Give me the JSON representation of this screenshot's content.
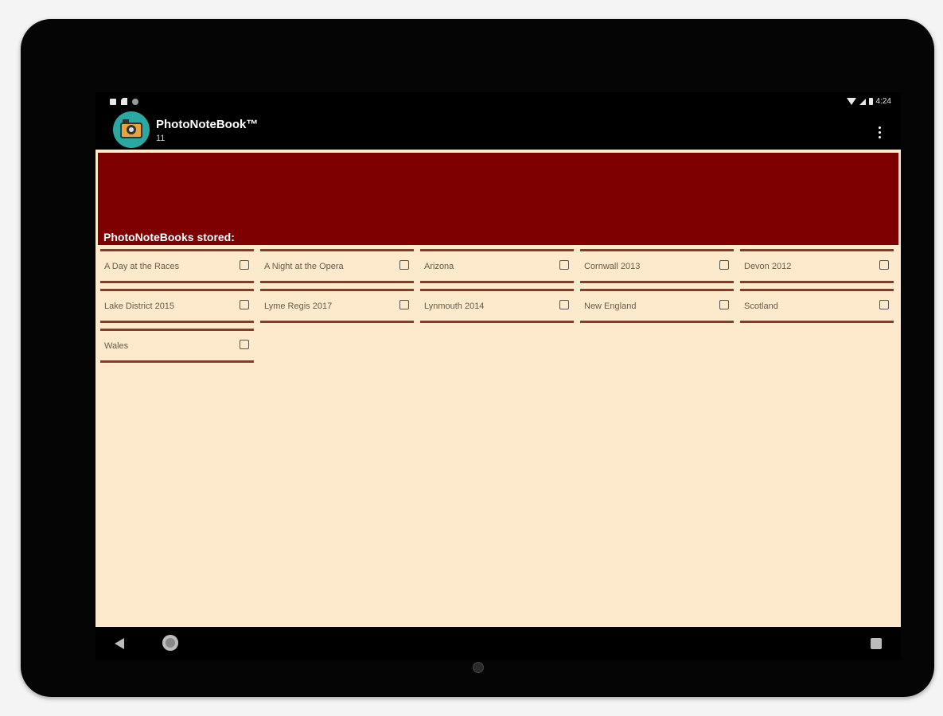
{
  "status_bar": {
    "time": "4:24"
  },
  "action_bar": {
    "title": "PhotoNoteBook™",
    "subtitle": "11"
  },
  "banner": {
    "label": "PhotoNoteBooks stored:"
  },
  "notebooks": [
    {
      "name": "A Day at the Races",
      "checked": false
    },
    {
      "name": "A Night at the Opera",
      "checked": false
    },
    {
      "name": "Arizona",
      "checked": false
    },
    {
      "name": "Cornwall 2013",
      "checked": false
    },
    {
      "name": "Devon 2012",
      "checked": false
    },
    {
      "name": "Lake District 2015",
      "checked": false
    },
    {
      "name": "Lyme Regis 2017",
      "checked": false
    },
    {
      "name": "Lynmouth 2014",
      "checked": false
    },
    {
      "name": "New England",
      "checked": false
    },
    {
      "name": "Scotland",
      "checked": false
    },
    {
      "name": "Wales",
      "checked": false
    }
  ],
  "colors": {
    "banner": "#7e0000",
    "background": "#fde9cc",
    "divider": "#8a3a2a"
  }
}
